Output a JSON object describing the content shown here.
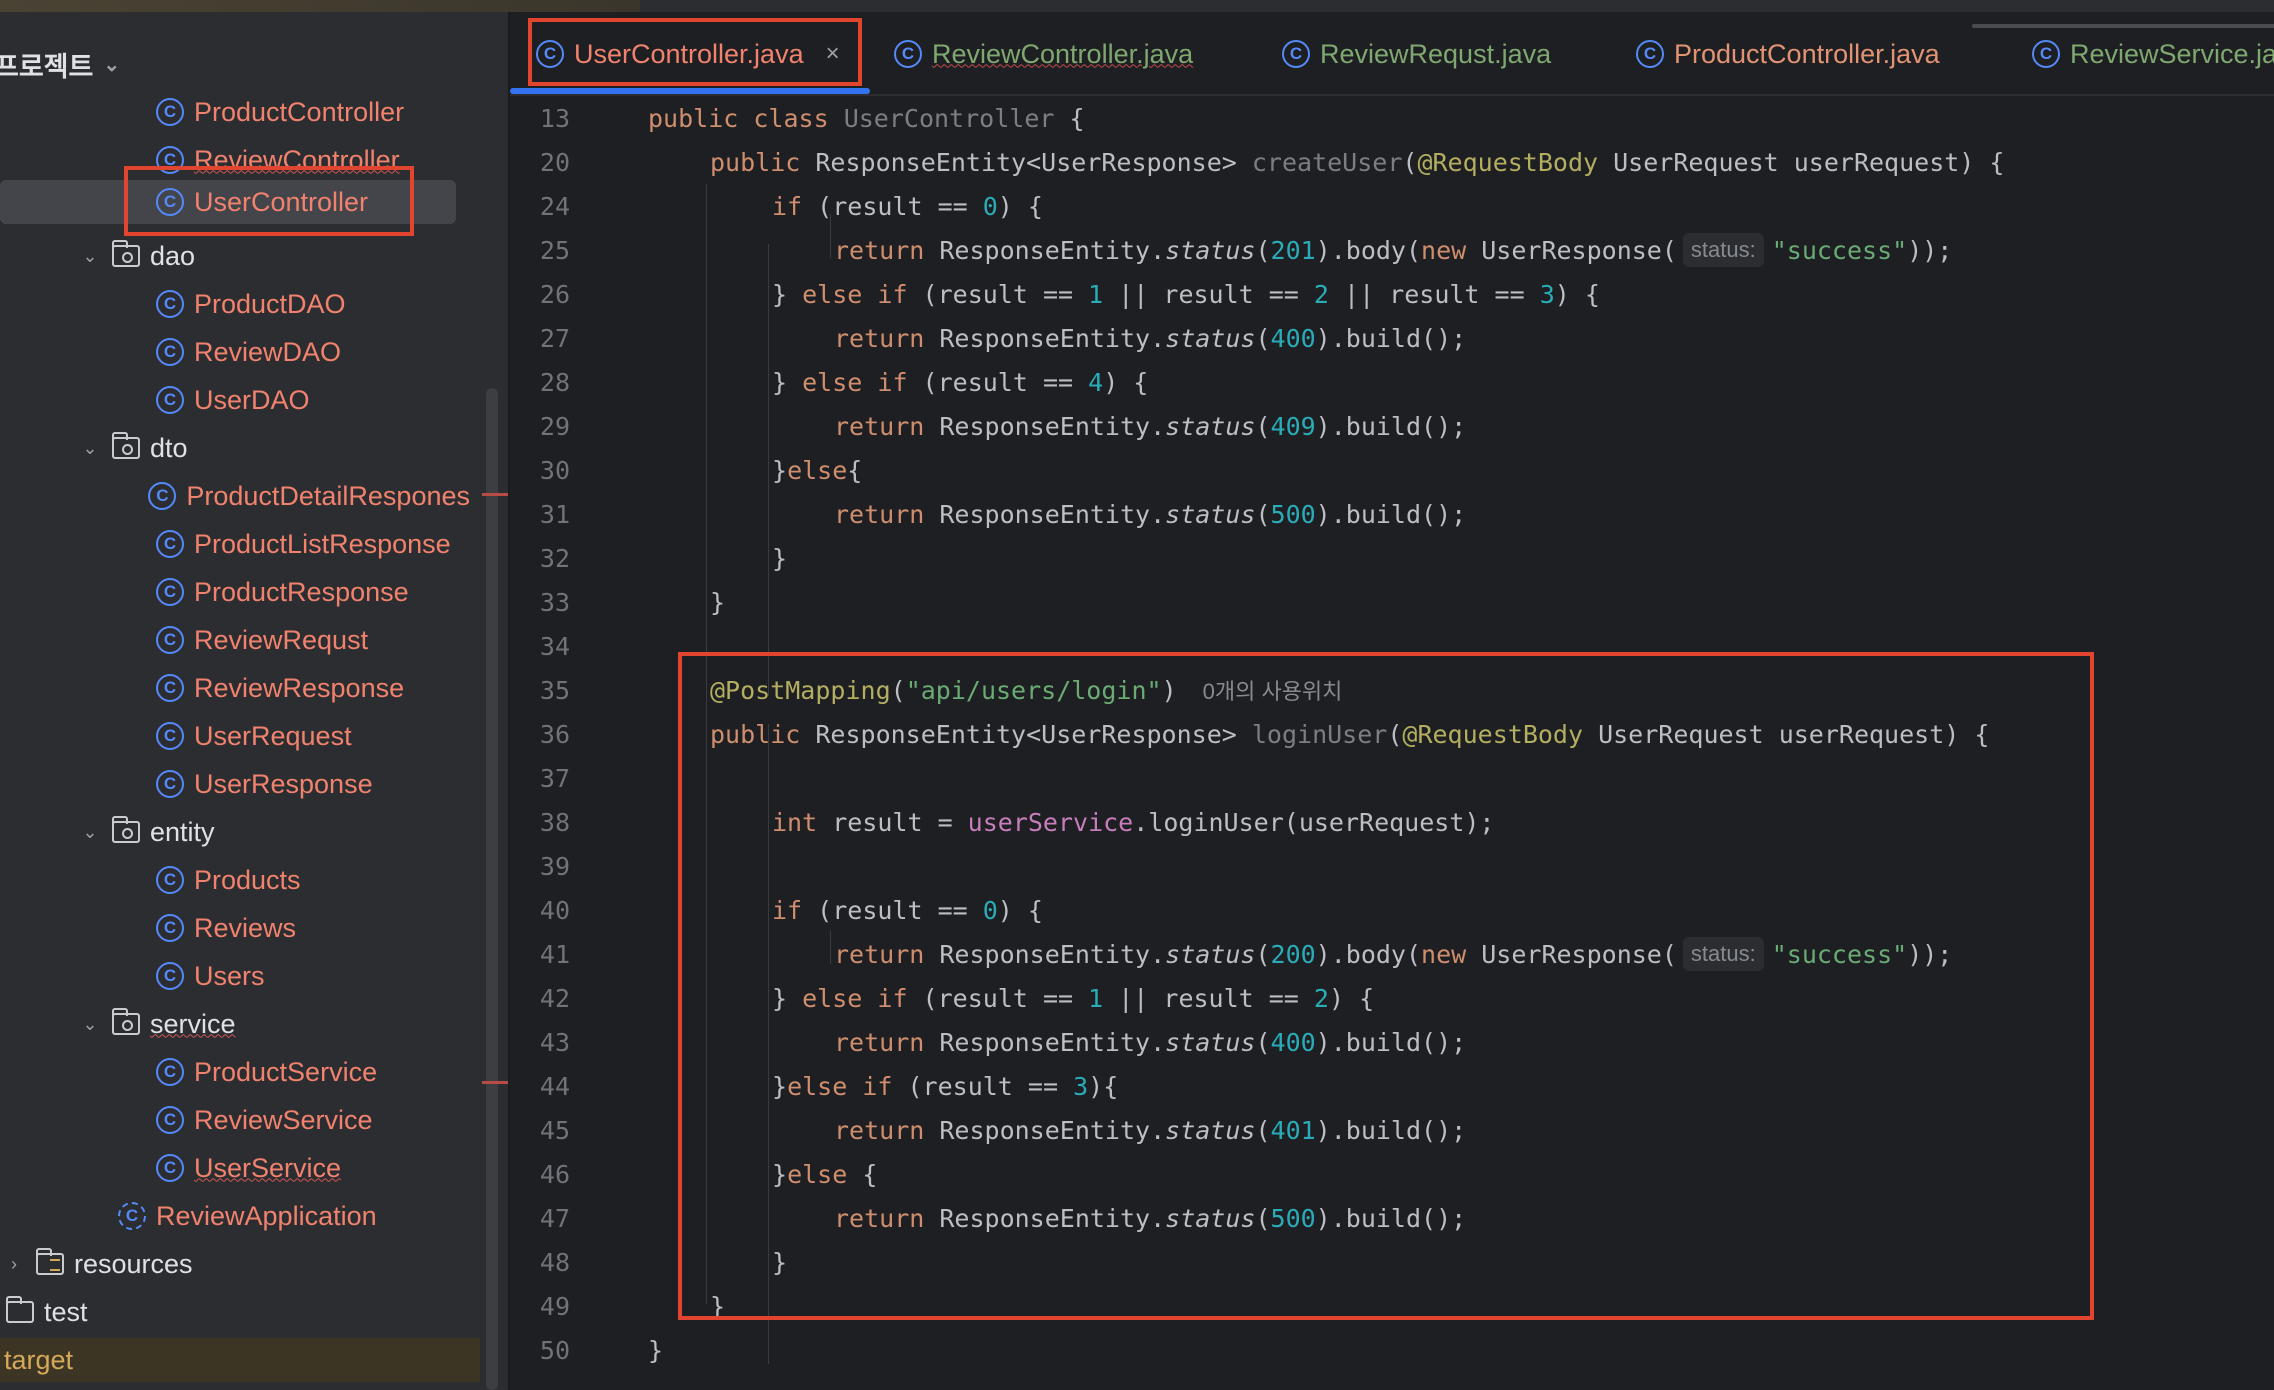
{
  "project_header": {
    "label": "프로젝트"
  },
  "tabs": [
    {
      "label": "UserController.java"
    },
    {
      "label": "ReviewController.java"
    },
    {
      "label": "ReviewRequst.java"
    },
    {
      "label": "ProductController.java"
    },
    {
      "label": "ReviewService.ja"
    }
  ],
  "tree": [
    {
      "label": "ProductController"
    },
    {
      "label": "ReviewController"
    },
    {
      "label": "UserController"
    },
    {
      "label": "dao"
    },
    {
      "label": "ProductDAO"
    },
    {
      "label": "ReviewDAO"
    },
    {
      "label": "UserDAO"
    },
    {
      "label": "dto"
    },
    {
      "label": "ProductDetailRespones"
    },
    {
      "label": "ProductListResponse"
    },
    {
      "label": "ProductResponse"
    },
    {
      "label": "ReviewRequst"
    },
    {
      "label": "ReviewResponse"
    },
    {
      "label": "UserRequest"
    },
    {
      "label": "UserResponse"
    },
    {
      "label": "entity"
    },
    {
      "label": "Products"
    },
    {
      "label": "Reviews"
    },
    {
      "label": "Users"
    },
    {
      "label": "service"
    },
    {
      "label": "ProductService"
    },
    {
      "label": "ReviewService"
    },
    {
      "label": "UserService"
    },
    {
      "label": "ReviewApplication"
    },
    {
      "label": "resources"
    },
    {
      "label": "test"
    },
    {
      "label": "target"
    }
  ],
  "code": {
    "line_numbers": [
      "13",
      "20",
      "24",
      "25",
      "26",
      "27",
      "28",
      "29",
      "30",
      "31",
      "32",
      "33",
      "34",
      "35",
      "36",
      "37",
      "38",
      "39",
      "40",
      "41",
      "42",
      "43",
      "44",
      "45",
      "46",
      "47",
      "48",
      "49",
      "50"
    ],
    "t": {
      "public": "public",
      "class": "class",
      "UserController": "UserController",
      "lbrace": " {",
      "ResponseEntityUR": "ResponseEntity<UserResponse>",
      "createUser": "createUser",
      "paren_open": "(",
      "RequestBody": "@RequestBody",
      "UserRequest_param": " UserRequest userRequest) {",
      "if": "if",
      "cond_open": " (result == ",
      "zero": "0",
      "close_brace_paren": ") {",
      "return": "return",
      "ResponseEntity_dot": " ResponseEntity.",
      "status": "status",
      "c201": "201",
      "body_new": ").body(",
      "new": "new",
      "UserResponse_open": " UserResponse(",
      "hint_status": "status:",
      "success": "\"success\"",
      "close_semi": "));",
      "close_else_if": "} ",
      "else": "else",
      "cond_one": " (result == ",
      "one": "1",
      "or_result": " || result == ",
      "two": "2",
      "three": "3",
      "c400": "400",
      "build": ").build();",
      "four": "4",
      "c409": "409",
      "else_brace_open": "}",
      "brace_open": "{",
      "c500": "500",
      "rbrace": "}",
      "PostMapping": "@PostMapping",
      "api_path": "\"api/users/login\"",
      "rparen": ")",
      "usages": "0개의 사용위치",
      "loginUser_decl": "loginUser",
      "int": "int",
      "result_eq": " result = ",
      "userService": "userService",
      "loginUser_call": ".loginUser(userRequest);",
      "c200": "200",
      "c401": "401",
      "rparen_brace": "){"
    }
  }
}
